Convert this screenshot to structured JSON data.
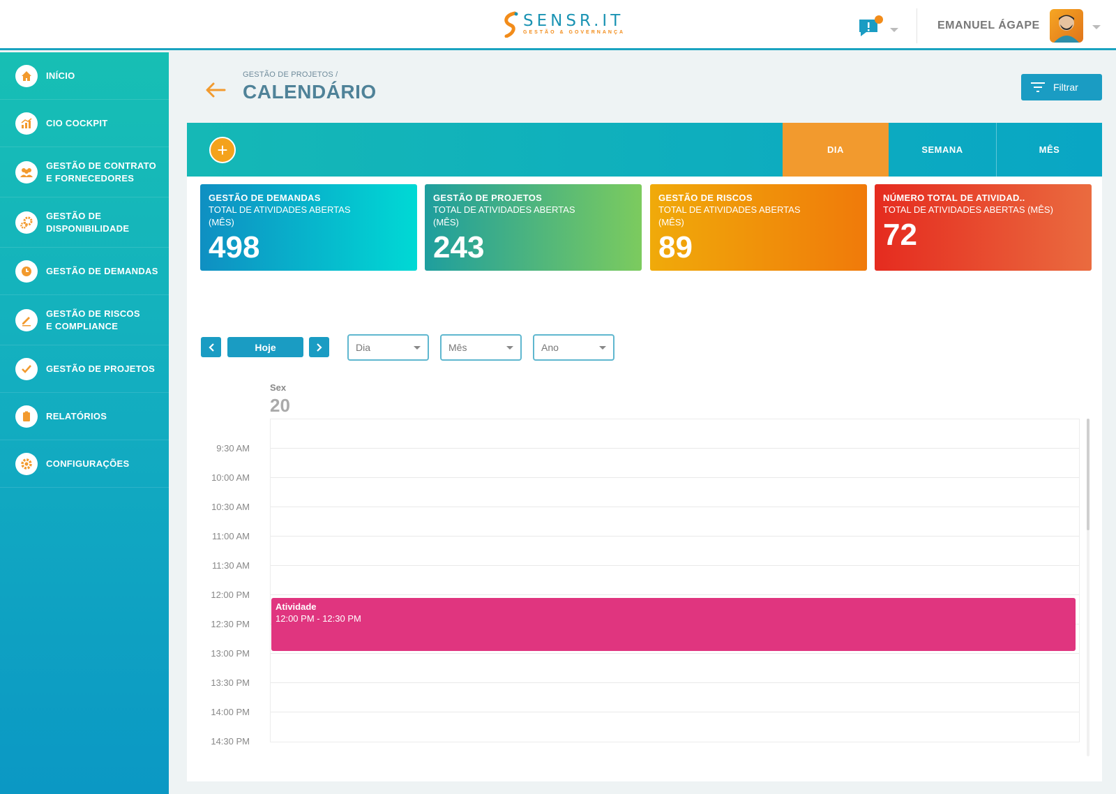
{
  "brand": {
    "title": "SENSR.IT",
    "subtitle": "GESTÃO & GOVERNANÇA",
    "accent": "#1a93b3",
    "secondary": "#f28c1a"
  },
  "header": {
    "user_name": "EMANUEL ÁGAPE",
    "notification_icon": "chat-alert-icon",
    "avatar": "avatar"
  },
  "sidebar": {
    "items": [
      {
        "label": "INÍCIO",
        "icon": "home-icon"
      },
      {
        "label": "CIO COCKPIT",
        "icon": "chart-icon"
      },
      {
        "label": "GESTÃO DE CONTRATO\nE FORNECEDORES",
        "icon": "people-icon"
      },
      {
        "label": "GESTÃO DE\nDISPONIBILIDADE",
        "icon": "gears-icon"
      },
      {
        "label": "GESTÃO DE DEMANDAS",
        "icon": "clock-icon"
      },
      {
        "label": "GESTÃO DE RISCOS\nE COMPLIANCE",
        "icon": "pencil-icon"
      },
      {
        "label": "GESTÃO DE PROJETOS",
        "icon": "check-icon"
      },
      {
        "label": "RELATÓRIOS",
        "icon": "clipboard-icon"
      },
      {
        "label": "CONFIGURAÇÕES",
        "icon": "gear-icon"
      }
    ]
  },
  "page": {
    "breadcrumb": "GESTÃO DE PROJETOS /",
    "title": "CALENDÁRIO",
    "filter_label": "Filtrar"
  },
  "view_tabs": [
    {
      "label": "DIA",
      "active": true
    },
    {
      "label": "SEMANA",
      "active": false
    },
    {
      "label": "MÊS",
      "active": false
    }
  ],
  "stats": [
    {
      "title": "GESTÃO DE DEMANDAS",
      "subtitle": "TOTAL DE ATIVIDADES ABERTAS (MÊS)",
      "value": "498"
    },
    {
      "title": "GESTÃO DE PROJETOS",
      "subtitle": "TOTAL DE ATIVIDADES ABERTAS (MÊS)",
      "value": "243"
    },
    {
      "title": "GESTÃO DE RISCOS",
      "subtitle": "TOTAL DE ATIVIDADES ABERTAS (MÊS)",
      "value": "89"
    },
    {
      "title": "NÚMERO TOTAL DE ATIVIDAD..",
      "subtitle": "TOTAL DE ATIVIDADES ABERTAS (MÊS)",
      "value": "72"
    }
  ],
  "calendar": {
    "today_label": "Hoje",
    "selects": {
      "day": "Dia",
      "month": "Mês",
      "year": "Ano"
    },
    "day_name": "Sex",
    "day_number": "20",
    "times": [
      "9:30 AM",
      "10:00 AM",
      "10:30 AM",
      "11:00 AM",
      "11:30 AM",
      "12:00 PM",
      "12:30 PM",
      "13:00 PM",
      "13:30 PM",
      "14:00 PM",
      "14:30 PM"
    ],
    "event": {
      "title": "Atividade",
      "time": "12:00 PM - 12:30 PM",
      "color": "#e0357f"
    }
  }
}
